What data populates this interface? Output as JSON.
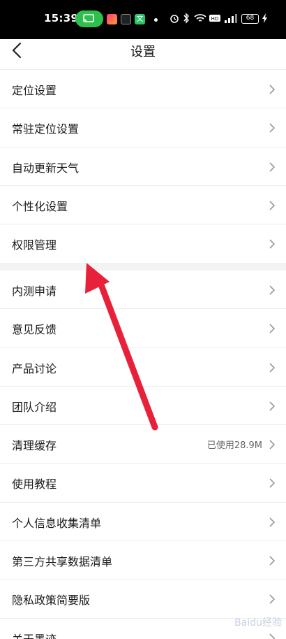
{
  "status_bar": {
    "time": "15:39",
    "battery": "68",
    "icons": [
      "cast-icon",
      "video-app-icon",
      "hd-app-icon",
      "translate-app-icon",
      "dot-icon",
      "alarm-icon",
      "bluetooth-icon",
      "wifi-icon",
      "hd-icon",
      "signal-icon",
      "battery-icon",
      "charging-icon"
    ],
    "app3_glyph": "文"
  },
  "header": {
    "title": "设置",
    "back_icon": "chevron-left-icon"
  },
  "section1": [
    {
      "label": "定位设置"
    },
    {
      "label": "常驻定位设置"
    },
    {
      "label": "自动更新天气"
    },
    {
      "label": "个性化设置"
    },
    {
      "label": "权限管理"
    }
  ],
  "section2": [
    {
      "label": "内测申请"
    },
    {
      "label": "意见反馈"
    },
    {
      "label": "产品讨论"
    },
    {
      "label": "团队介绍"
    },
    {
      "label": "清理缓存",
      "value": "已使用28.9M"
    },
    {
      "label": "使用教程"
    },
    {
      "label": "个人信息收集清单"
    },
    {
      "label": "第三方共享数据清单"
    },
    {
      "label": "隐私政策简要版"
    },
    {
      "label": "关于墨迹"
    }
  ],
  "annotation": {
    "color": "#e8213a"
  },
  "watermark": "Baidu经验"
}
